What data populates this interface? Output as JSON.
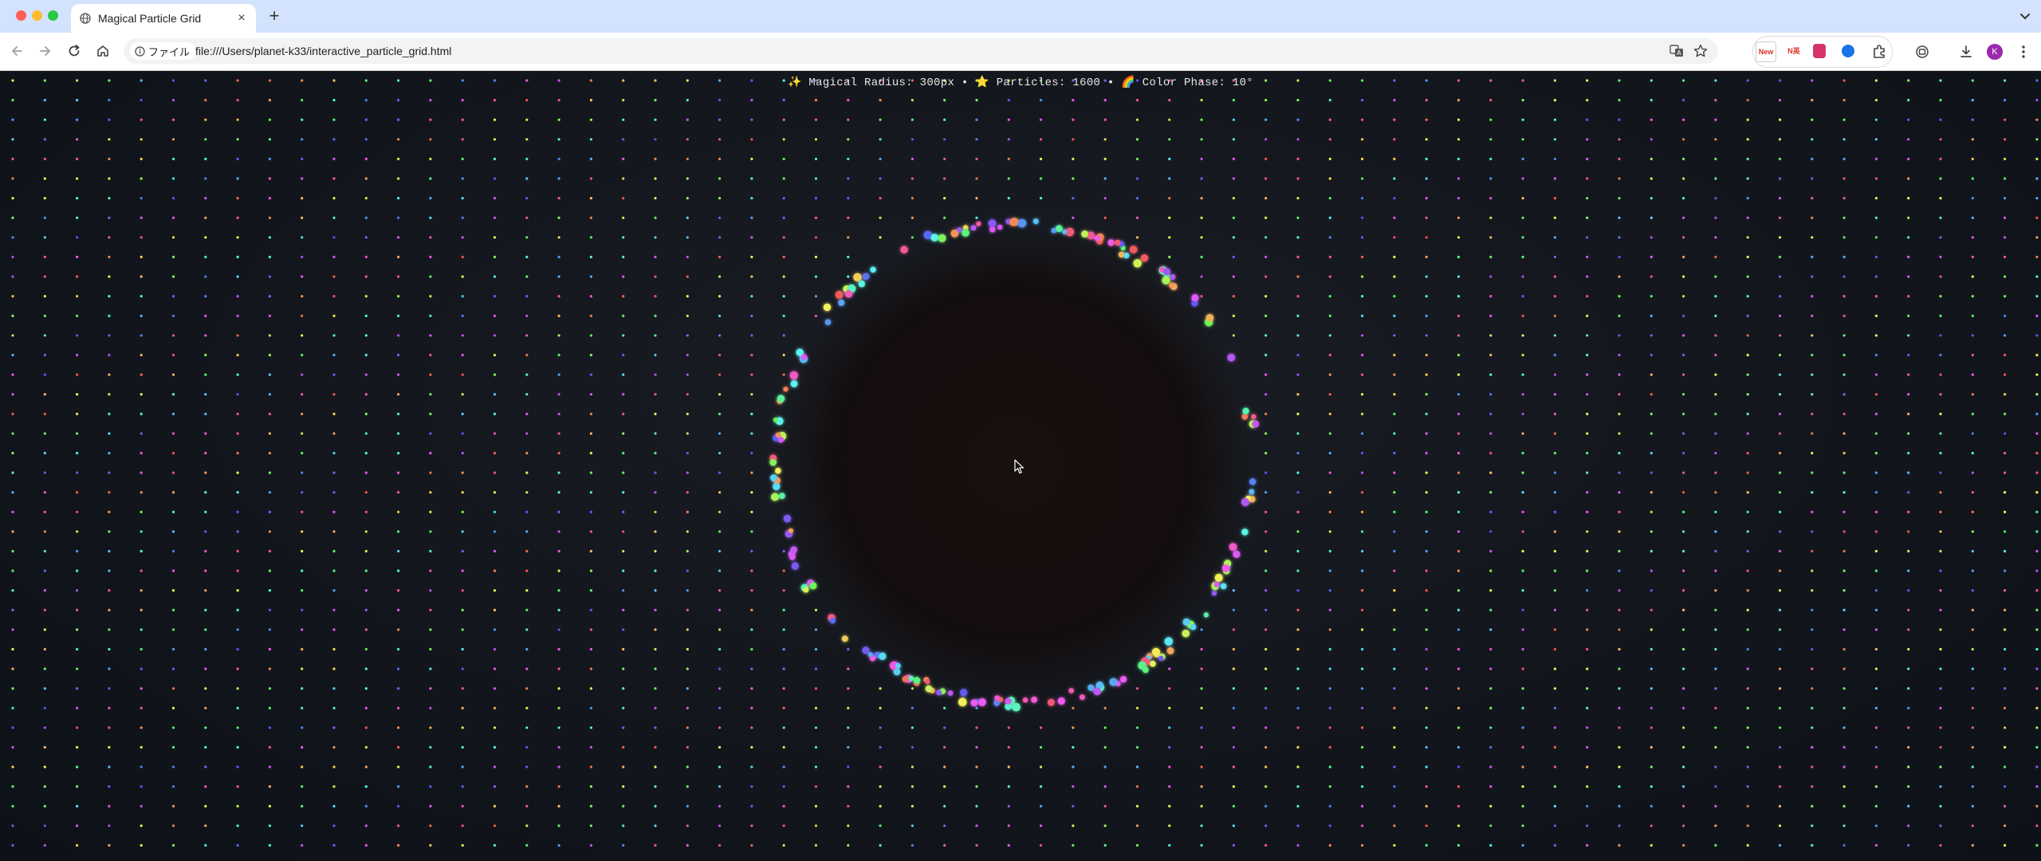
{
  "browser": {
    "tab": {
      "title": "Magical Particle Grid",
      "favicon": "globe-icon",
      "close_label": "×"
    },
    "new_tab_label": "+",
    "site_info_label": "ファイル",
    "url": "file:///Users/planet-k33/interactive_particle_grid.html",
    "extensions": [
      {
        "name": "new-badge-extension",
        "label": "New",
        "color": "#d93025"
      },
      {
        "name": "news-extension",
        "label": "N英",
        "color": "#ffffff"
      },
      {
        "name": "pocket-extension",
        "label": "",
        "color": "#d6336c"
      },
      {
        "name": "translate-blue-extension",
        "label": "",
        "color": "#1a73e8"
      }
    ],
    "profile_initial": "K",
    "profile_color": "#9c27b0"
  },
  "page": {
    "hud_text": "✨ Magical Radius: 300px • ⭐ Particles: 1600 • 🌈 Color Phase: 10°",
    "magical_radius": "300px",
    "particle_count": "1600",
    "color_phase": "10°",
    "background_color": "#12161c"
  }
}
